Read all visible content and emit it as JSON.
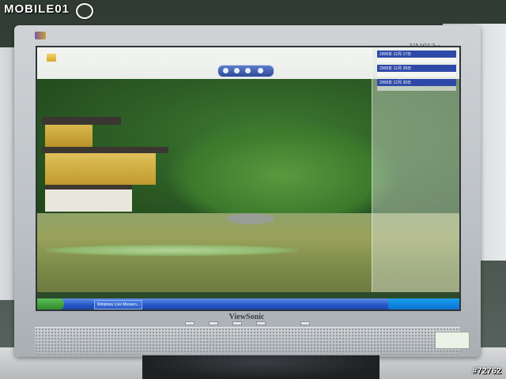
{
  "watermark": {
    "text": "MOBILE01",
    "photo_id": "#72762"
  },
  "monitor": {
    "model_label": "VA1912w",
    "brand_label": "ViewSonic",
    "sticker_text": ""
  },
  "desktop": {
    "gadgets": [
      {
        "header": "2006年 12月 17日",
        "body": ""
      },
      {
        "header": "2006年 12月 28日",
        "body": ""
      },
      {
        "header": "2006年 12月 30日",
        "body": ""
      }
    ],
    "taskbar": {
      "start_label": "",
      "task_label": "Windows Live Messen..."
    }
  },
  "colors": {
    "taskbar_blue": "#2456c7",
    "start_green": "#2f8a2a",
    "gadget_header": "#2f49a8"
  }
}
